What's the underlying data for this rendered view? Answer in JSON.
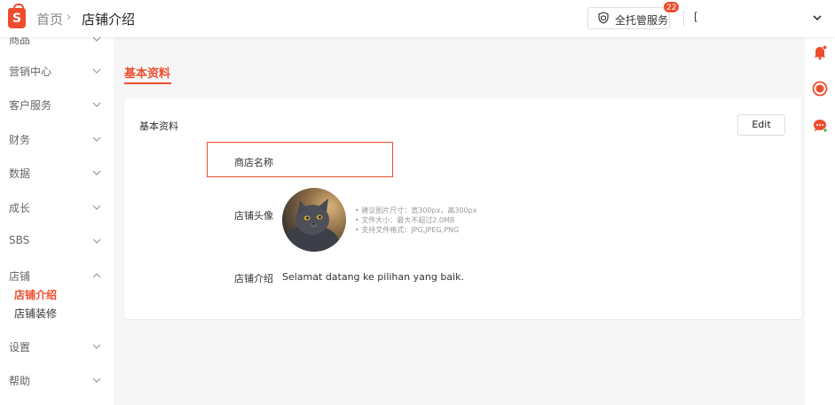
{
  "header": {
    "logo_letter": "S",
    "breadcrumb_home": "首页",
    "breadcrumb_separator": "›",
    "breadcrumb_current": "店铺介绍",
    "service_button_label": "全托管服务",
    "notification_count": "22",
    "user_name": "["
  },
  "sidebar": {
    "items": [
      {
        "label": "商品"
      },
      {
        "label": "营销中心"
      },
      {
        "label": "客户服务"
      },
      {
        "label": "财务"
      },
      {
        "label": "数据"
      },
      {
        "label": "成长"
      },
      {
        "label": "SBS"
      },
      {
        "label": "店铺"
      },
      {
        "label": "设置"
      },
      {
        "label": "帮助"
      }
    ],
    "shop_subitems": [
      {
        "label": "店铺介绍",
        "active": true
      },
      {
        "label": "店铺装修",
        "active": false
      }
    ]
  },
  "main": {
    "tab_label": "基本资料",
    "card": {
      "title": "基本资料",
      "edit_label": "Edit",
      "shop_name_label": "商店名称",
      "avatar_label": "店铺头像",
      "avatar_hints": [
        "• 建议图片尺寸：宽300px，高300px",
        "• 文件大小：最大不超过2.0MB",
        "• 支持文件格式：JPG,JPEG,PNG"
      ],
      "intro_label": "店铺介绍",
      "intro_text": "Selamat datang ke pilihan yang baik."
    }
  },
  "colors": {
    "accent": "#ee4d2d",
    "background": "#f6f6f6"
  },
  "icons": {
    "logo": "shopee-bag-icon",
    "service": "shield-box-icon",
    "rail": [
      "bell-icon",
      "live-circle-icon",
      "chat-icon"
    ]
  }
}
